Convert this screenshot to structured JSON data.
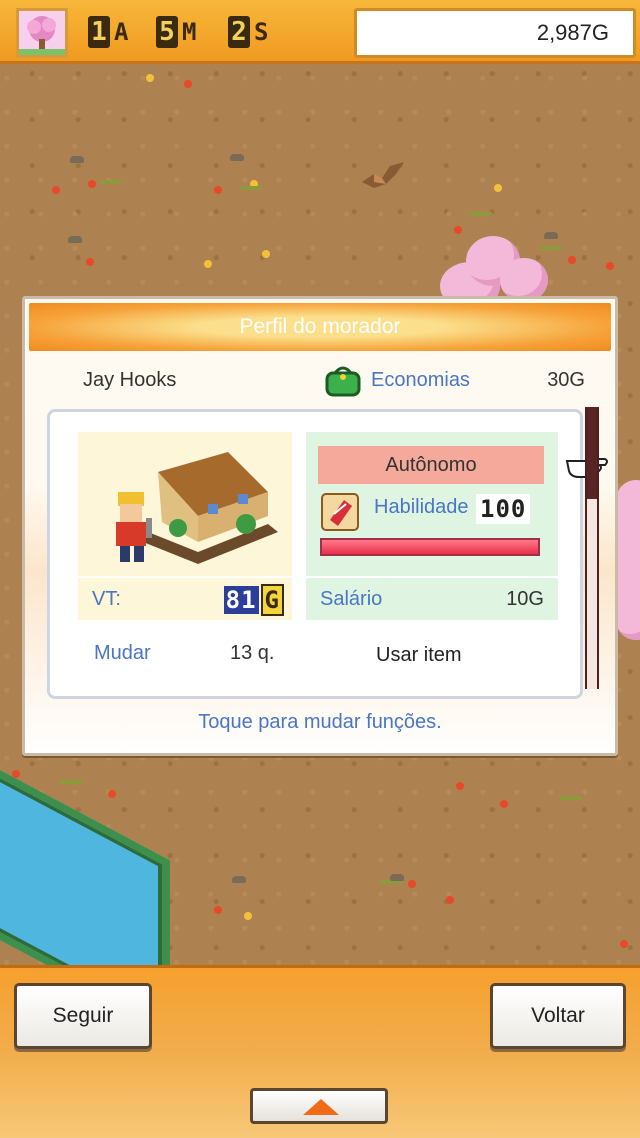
{
  "hud": {
    "time": {
      "years": "1",
      "years_unit": "A",
      "months": "5",
      "months_unit": "M",
      "weeks": "2",
      "weeks_unit": "S"
    },
    "money": "2,987G",
    "season_icon": "cherry-blossom-tree-icon"
  },
  "dialog": {
    "title": "Perfil do morador",
    "resident_name": "Jay Hooks",
    "savings_label": "Economias",
    "savings_value": "30G",
    "vt_label": "VT:",
    "vt_digits": "81",
    "vt_unit": "G",
    "job": "Autônomo",
    "skill_label": "Habilidade",
    "skill_value": "100",
    "skill_level": 1.0,
    "salary_label": "Salário",
    "salary_value": "10G",
    "move_label": "Mudar",
    "move_value": "13 q.",
    "use_item": "Usar item",
    "hint": "Toque para mudar funções."
  },
  "buttons": {
    "follow": "Seguir",
    "back": "Voltar"
  },
  "colors": {
    "accent_orange": "#f09a20",
    "label_blue": "#4a76c2",
    "job_badge": "#f4a99a",
    "skill_bar": "#e8304a"
  }
}
